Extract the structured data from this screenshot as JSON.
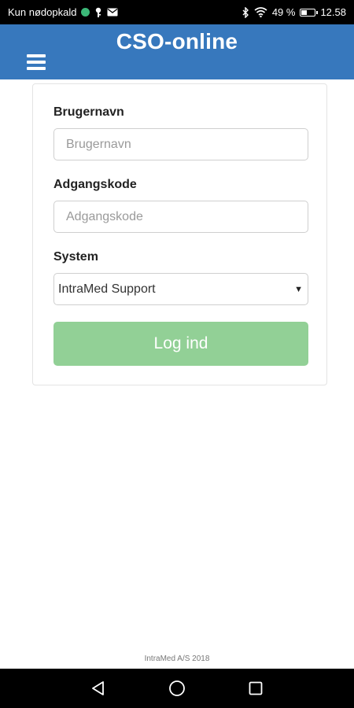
{
  "status_bar": {
    "carrier": "Kun nødopkald",
    "battery_percent": "49 %",
    "time": "12.58",
    "battery_level": 0.49,
    "icons": [
      "notification-dot-icon",
      "key-icon",
      "mail-icon",
      "bluetooth-icon",
      "wifi-icon",
      "battery-icon"
    ]
  },
  "app": {
    "title": "CSO-online",
    "header_color": "#3778bd",
    "menu_icon": "hamburger-menu-icon"
  },
  "login_form": {
    "username_label": "Brugernavn",
    "username_placeholder": "Brugernavn",
    "username_value": "",
    "password_label": "Adgangskode",
    "password_placeholder": "Adgangskode",
    "password_value": "",
    "system_label": "System",
    "system_selected": "IntraMed Support",
    "login_button": "Log ind",
    "login_button_color": "#92d096"
  },
  "footer": {
    "copyright": "IntraMed A/S 2018"
  },
  "nav_bar": {
    "icons": [
      "back-icon",
      "home-icon",
      "recents-icon"
    ]
  }
}
